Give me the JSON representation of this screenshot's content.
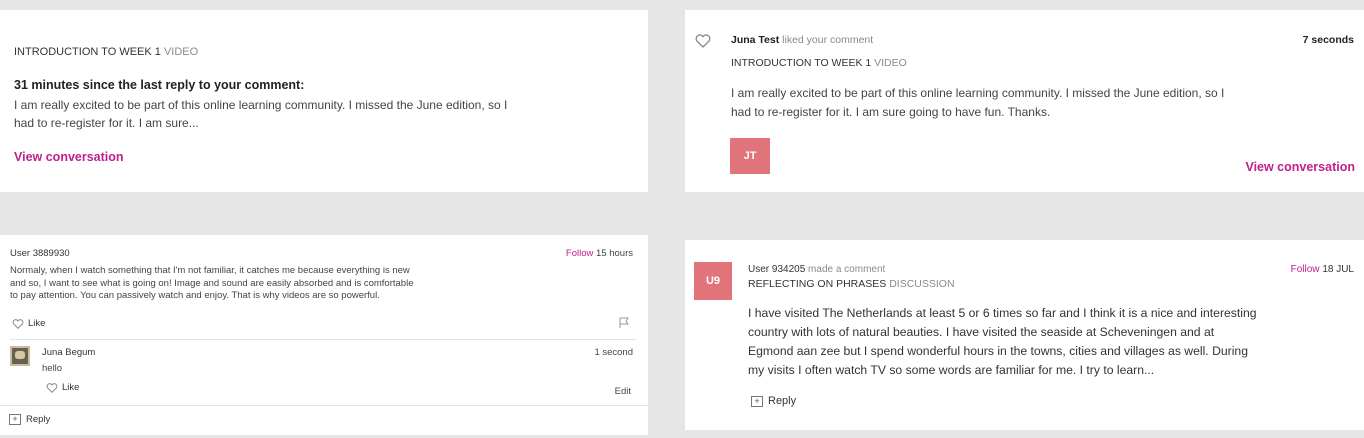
{
  "card1": {
    "step_title": "INTRODUCTION TO WEEK 1",
    "step_type": "VIDEO",
    "headline": "31 minutes since the last reply to your comment:",
    "excerpt_line1": "I am really excited to be part of this online learning community. I missed the June edition, so I",
    "excerpt_line2": "had to re-register for it. I am sure...",
    "link": "View conversation"
  },
  "card2": {
    "user": "Juna Test",
    "action": "liked your comment",
    "time": "7 seconds",
    "step_title": "INTRODUCTION TO WEEK 1",
    "step_type": "VIDEO",
    "body_line1": "I am really excited to be part of this online learning community. I missed the June edition, so I",
    "body_line2": "had to re-register for it. I am sure going to have fun. Thanks.",
    "avatar_initials": "JT",
    "link": "View conversation"
  },
  "card3": {
    "user": "User 3889930",
    "follow": "Follow",
    "time": "15 hours",
    "body_line1": "Normaly, when I watch something that I'm not familiar, it catches me because everything is new",
    "body_line2": "and so, I want to see what is going on! Image and sound are easily absorbed and is comfortable",
    "body_line3": "to pay attention. You can passively watch and enjoy. That is why videos are so powerful.",
    "like": "Like",
    "reply_user": "Juna Begum",
    "reply_time": "1 second",
    "reply_text": "hello",
    "reply_like": "Like",
    "edit": "Edit",
    "reply": "Reply"
  },
  "card4": {
    "avatar_initials": "U9",
    "user": "User 934205",
    "action": "made a comment",
    "follow": "Follow",
    "date": "18 JUL",
    "step_title": "REFLECTING ON PHRASES",
    "step_type": "DISCUSSION",
    "body_line1": "I have visited The Netherlands at least 5 or 6 times so far and I think it is a nice and interesting",
    "body_line2": "country with lots of natural beauties. I have visited the seaside at Scheveningen and at",
    "body_line3": "Egmond aan zee but I spend wonderful hours in the towns, cities and villages as well. During",
    "body_line4": "my visits I often watch TV so some words are familiar for me. I try to learn...",
    "reply": "Reply"
  },
  "colors": {
    "accent": "#c0208c",
    "avatar": "#e0747a",
    "background": "#e6e6e6"
  }
}
